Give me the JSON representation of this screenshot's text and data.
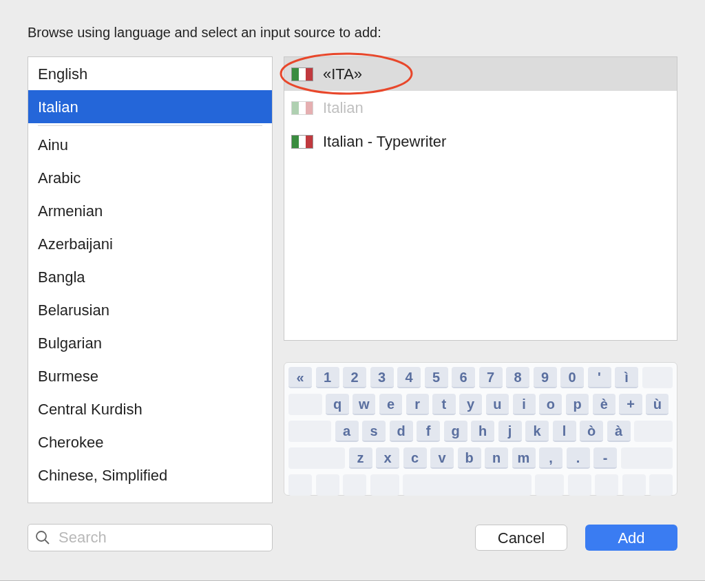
{
  "prompt": "Browse using language and select an input source to add:",
  "languages": [
    {
      "label": "English",
      "selected": false,
      "divider_above": false
    },
    {
      "label": "Italian",
      "selected": true,
      "divider_above": false
    },
    {
      "label": "Ainu",
      "selected": false,
      "divider_above": true
    },
    {
      "label": "Arabic",
      "selected": false,
      "divider_above": false
    },
    {
      "label": "Armenian",
      "selected": false,
      "divider_above": false
    },
    {
      "label": "Azerbaijani",
      "selected": false,
      "divider_above": false
    },
    {
      "label": "Bangla",
      "selected": false,
      "divider_above": false
    },
    {
      "label": "Belarusian",
      "selected": false,
      "divider_above": false
    },
    {
      "label": "Bulgarian",
      "selected": false,
      "divider_above": false
    },
    {
      "label": "Burmese",
      "selected": false,
      "divider_above": false
    },
    {
      "label": "Central Kurdish",
      "selected": false,
      "divider_above": false
    },
    {
      "label": "Cherokee",
      "selected": false,
      "divider_above": false
    },
    {
      "label": "Chinese, Simplified",
      "selected": false,
      "divider_above": false
    }
  ],
  "sources": [
    {
      "label": "«ITA»",
      "selected": true,
      "disabled": false,
      "circled": true
    },
    {
      "label": "Italian",
      "selected": false,
      "disabled": true,
      "circled": false
    },
    {
      "label": "Italian - Typewriter",
      "selected": false,
      "disabled": false,
      "circled": false
    }
  ],
  "keyboard": {
    "rows": [
      [
        "«",
        "1",
        "2",
        "3",
        "4",
        "5",
        "6",
        "7",
        "8",
        "9",
        "0",
        "'",
        "ì"
      ],
      [
        "q",
        "w",
        "e",
        "r",
        "t",
        "y",
        "u",
        "i",
        "o",
        "p",
        "è",
        "+",
        "ù"
      ],
      [
        "a",
        "s",
        "d",
        "f",
        "g",
        "h",
        "j",
        "k",
        "l",
        "ò",
        "à"
      ],
      [
        "z",
        "x",
        "c",
        "v",
        "b",
        "n",
        "m",
        ",",
        ".",
        "-"
      ]
    ]
  },
  "search": {
    "placeholder": "Search"
  },
  "buttons": [
    {
      "label": "Cancel",
      "kind": "secondary"
    },
    {
      "label": "Add",
      "kind": "primary"
    }
  ]
}
